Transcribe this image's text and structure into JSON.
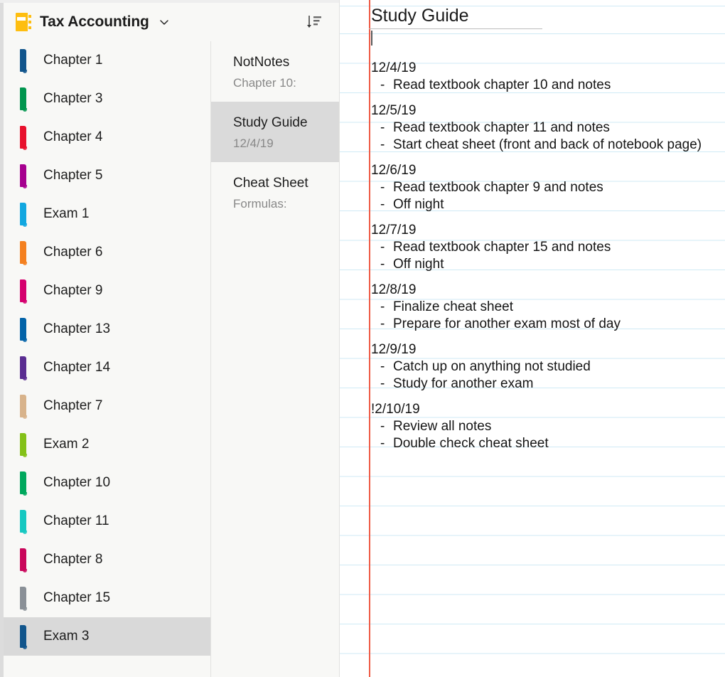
{
  "header": {
    "notebook_icon": "notebook-icon",
    "notebook_title": "Tax Accounting",
    "chevron_icon": "chevron-down-icon",
    "sort_icon": "sort-descending-icon"
  },
  "sections": {
    "items": [
      {
        "label": "Chapter 1",
        "color": "#11558c",
        "selected": false
      },
      {
        "label": "Chapter 3",
        "color": "#00954e",
        "selected": false
      },
      {
        "label": "Chapter 4",
        "color": "#e8112d",
        "selected": false
      },
      {
        "label": "Chapter 5",
        "color": "#a6008f",
        "selected": false
      },
      {
        "label": "Exam 1",
        "color": "#12a7e0",
        "selected": false
      },
      {
        "label": "Chapter 6",
        "color": "#f4801f",
        "selected": false
      },
      {
        "label": "Chapter 9",
        "color": "#d5006e",
        "selected": false
      },
      {
        "label": "Chapter 13",
        "color": "#0263a8",
        "selected": false
      },
      {
        "label": "Chapter 14",
        "color": "#5a2d91",
        "selected": false
      },
      {
        "label": "Chapter 7",
        "color": "#d8b38b",
        "selected": false
      },
      {
        "label": "Exam 2",
        "color": "#84c118",
        "selected": false
      },
      {
        "label": "Chapter 10",
        "color": "#00a85d",
        "selected": false
      },
      {
        "label": "Chapter 11",
        "color": "#16c8c1",
        "selected": false
      },
      {
        "label": "Chapter 8",
        "color": "#c9065a",
        "selected": false
      },
      {
        "label": "Chapter 15",
        "color": "#8a9097",
        "selected": false
      },
      {
        "label": "Exam 3",
        "color": "#11558c",
        "selected": true
      }
    ]
  },
  "pages": {
    "items": [
      {
        "title": "NotNotes",
        "subtitle": "Chapter 10:",
        "selected": false
      },
      {
        "title": "Study Guide",
        "subtitle": "12/4/19",
        "selected": true
      },
      {
        "title": "Cheat Sheet",
        "subtitle": "Formulas:",
        "selected": false
      }
    ]
  },
  "note": {
    "title": "Study Guide",
    "blocks": [
      {
        "date": "12/4/19",
        "bullets": [
          "Read textbook chapter 10 and notes"
        ]
      },
      {
        "date": "12/5/19",
        "bullets": [
          "Read textbook chapter 11 and notes",
          "Start cheat sheet (front and back of notebook page)"
        ]
      },
      {
        "date": "12/6/19",
        "bullets": [
          "Read textbook chapter 9 and notes",
          "Off night"
        ]
      },
      {
        "date": "12/7/19",
        "bullets": [
          "Read textbook chapter 15 and notes",
          "Off night"
        ]
      },
      {
        "date": "12/8/19",
        "bullets": [
          "Finalize cheat sheet",
          "Prepare for another exam most of day"
        ]
      },
      {
        "date": "12/9/19",
        "bullets": [
          "Catch up on anything not studied",
          "Study for another exam"
        ]
      },
      {
        "date": "!2/10/19",
        "bullets": [
          "Review all notes",
          "Double check cheat sheet"
        ]
      }
    ],
    "bullet_marker": "-"
  },
  "colors": {
    "panel_background": "#f8f8f6",
    "selection_background": "#d9d9d9",
    "page_selection_background": "#dadada",
    "rule_line": "#cfeaf5",
    "margin_line": "#ee5a44",
    "notebook_accent": "#febe10"
  }
}
